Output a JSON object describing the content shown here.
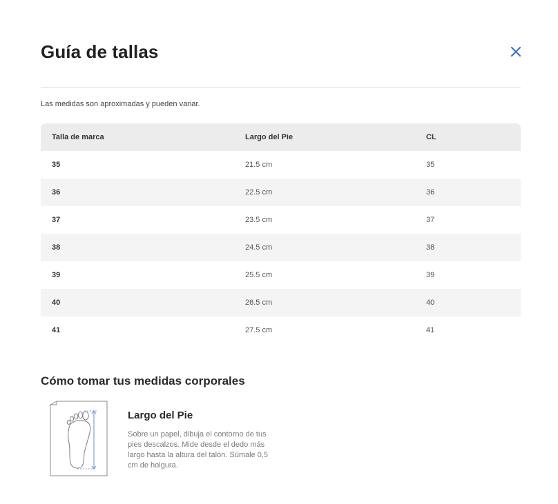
{
  "modal": {
    "title": "Guía de tallas",
    "note": "Las medidas son aproximadas y pueden variar."
  },
  "table": {
    "headers": [
      "Talla de marca",
      "Largo del Pie",
      "CL"
    ],
    "rows": [
      [
        "35",
        "21.5 cm",
        "35"
      ],
      [
        "36",
        "22.5 cm",
        "36"
      ],
      [
        "37",
        "23.5 cm",
        "37"
      ],
      [
        "38",
        "24.5 cm",
        "38"
      ],
      [
        "39",
        "25.5 cm",
        "39"
      ],
      [
        "40",
        "26.5 cm",
        "40"
      ],
      [
        "41",
        "27.5 cm",
        "41"
      ]
    ]
  },
  "measurements": {
    "title": "Cómo tomar tus medidas corporales",
    "items": [
      {
        "icon": "foot-length-icon",
        "title": "Largo del Pie",
        "description": "Sobre un papel, dibuja el contorno de tus pies descalzos. Mide desde el dedo más largo hasta la altura del talón. Súmale 0,5 cm de holgura."
      }
    ]
  },
  "icons": {
    "close": "close-icon"
  },
  "colors": {
    "accent": "#3b74c9",
    "header_bg": "#ececec",
    "stripe_bg": "#f4f4f4"
  }
}
